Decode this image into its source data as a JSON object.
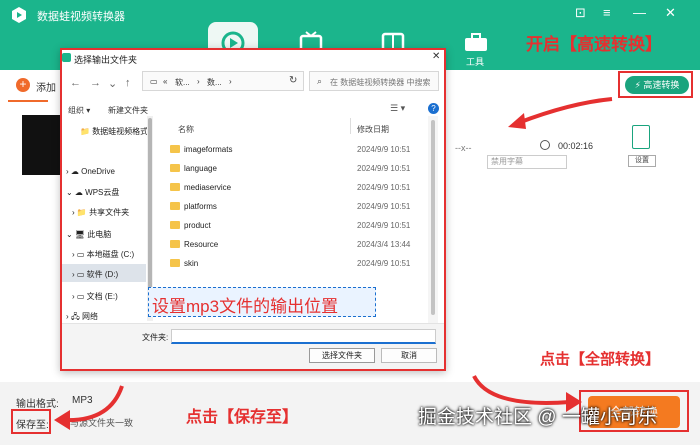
{
  "app": {
    "title": "数据蛙视频转换器",
    "tools_label": "工具",
    "add_label": "添加",
    "fast_convert": "高速转换",
    "duration": "00:02:16",
    "dash_text": "--x--",
    "subtitle_placeholder": "禁用字幕",
    "settings_label": "设置",
    "output_format_label": "输出格式:",
    "output_format_value": "MP3",
    "save_to_label": "保存至:",
    "save_to_value": "与源文件夹一致",
    "convert_all": "全部转换",
    "accent_color": "#1bb58c",
    "orange_color": "#f47a20"
  },
  "dialog": {
    "title": "选择输出文件夹",
    "close": "✕",
    "address": [
      "«",
      "软...",
      "›",
      "数...",
      "›"
    ],
    "search_placeholder": "在 数据蛙视频转换器 中搜索",
    "organize": "组织 ▾",
    "new_folder": "新建文件夹",
    "nav_items": [
      {
        "label": "数据蛙视频格式"
      },
      {
        "label": "OneDrive"
      },
      {
        "label": "WPS云盘"
      },
      {
        "label": "共享文件夹"
      },
      {
        "label": "此电脑"
      },
      {
        "label": "本地磁盘 (C:)"
      },
      {
        "label": "软件 (D:)"
      },
      {
        "label": "文档 (E:)"
      },
      {
        "label": "网络"
      }
    ],
    "columns": {
      "name": "名称",
      "modified": "修改日期"
    },
    "rows": [
      {
        "name": "imageformats",
        "date": "2024/9/9 10:51"
      },
      {
        "name": "language",
        "date": "2024/9/9 10:51"
      },
      {
        "name": "mediaservice",
        "date": "2024/9/9 10:51"
      },
      {
        "name": "platforms",
        "date": "2024/9/9 10:51"
      },
      {
        "name": "product",
        "date": "2024/9/9 10:51"
      },
      {
        "name": "Resource",
        "date": "2024/3/4 13:44"
      },
      {
        "name": "skin",
        "date": "2024/9/9 10:51"
      }
    ],
    "filename_label": "文件夹:",
    "select_button": "选择文件夹",
    "cancel_button": "取消"
  },
  "annotations": {
    "enable_fast": "开启【高速转换】",
    "set_output": "设置mp3文件的输出位置",
    "click_convert_all": "点击【全部转换】",
    "click_save_to": "点击【保存至】",
    "watermark": "掘金技术社区 @ 一罐小可乐"
  }
}
